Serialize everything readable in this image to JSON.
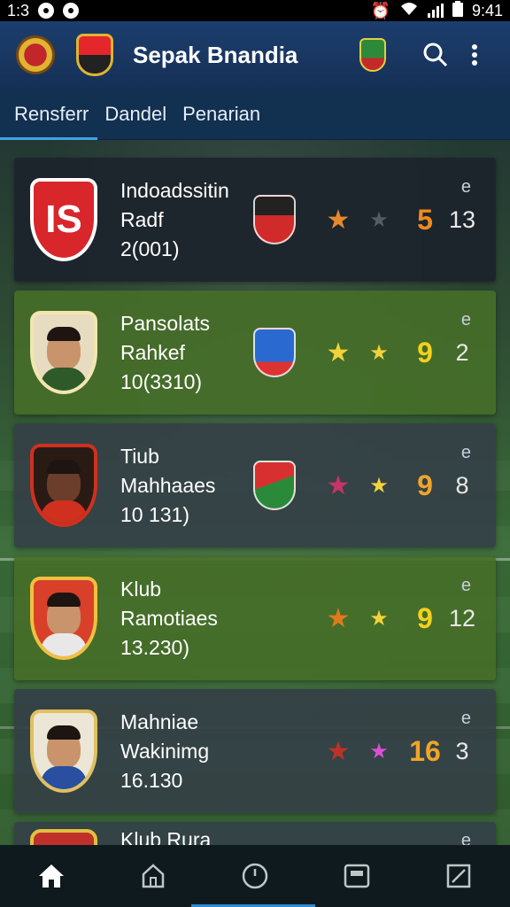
{
  "status_bar": {
    "time": "1:3",
    "clock": "9:41"
  },
  "app_bar": {
    "title": "Sepak Bnandia"
  },
  "tabs": [
    {
      "label": "Rensferr",
      "active": true
    },
    {
      "label": "Dandel",
      "active": false
    },
    {
      "label": "Penarian",
      "active": false
    }
  ],
  "list": [
    {
      "line1": "Indoadssitin",
      "line2": "Radf",
      "line3": "2(001)",
      "score": "5",
      "count": "13",
      "more": "e",
      "score_color": "#f08a1e",
      "star1_color": "#e8882c",
      "star2_color": "#555c64",
      "theme": "dark"
    },
    {
      "line1": "Pansolats",
      "line2": "Rahkef",
      "line3": "10(3310)",
      "score": "9",
      "count": "2",
      "more": "e",
      "score_color": "#f5d11b",
      "star1_color": "#f2d23a",
      "star2_color": "#f2d23a",
      "theme": "green"
    },
    {
      "line1": "Tiub",
      "line2": "Mahhaaes",
      "line3": "10 131)",
      "score": "9",
      "count": "8",
      "more": "e",
      "score_color": "#f0a52a",
      "star1_color": "#c8336a",
      "star2_color": "#f2d23a",
      "theme": "slate"
    },
    {
      "line1": "Klub",
      "line2": "Ramotiaes",
      "line3": "13.230)",
      "score": "9",
      "count": "12",
      "more": "e",
      "score_color": "#f5d11b",
      "star1_color": "#e07a1e",
      "star2_color": "#f2d23a",
      "theme": "green"
    },
    {
      "line1": "Mahniae",
      "line2": "Wakinimg",
      "line3": "16.130",
      "score": "16",
      "count": "3",
      "more": "e",
      "score_color": "#f0a52a",
      "star1_color": "#c0302a",
      "star2_color": "#d850d8",
      "theme": "slate"
    },
    {
      "line1": "Klub Rura",
      "more": "e",
      "theme": "slate"
    }
  ]
}
